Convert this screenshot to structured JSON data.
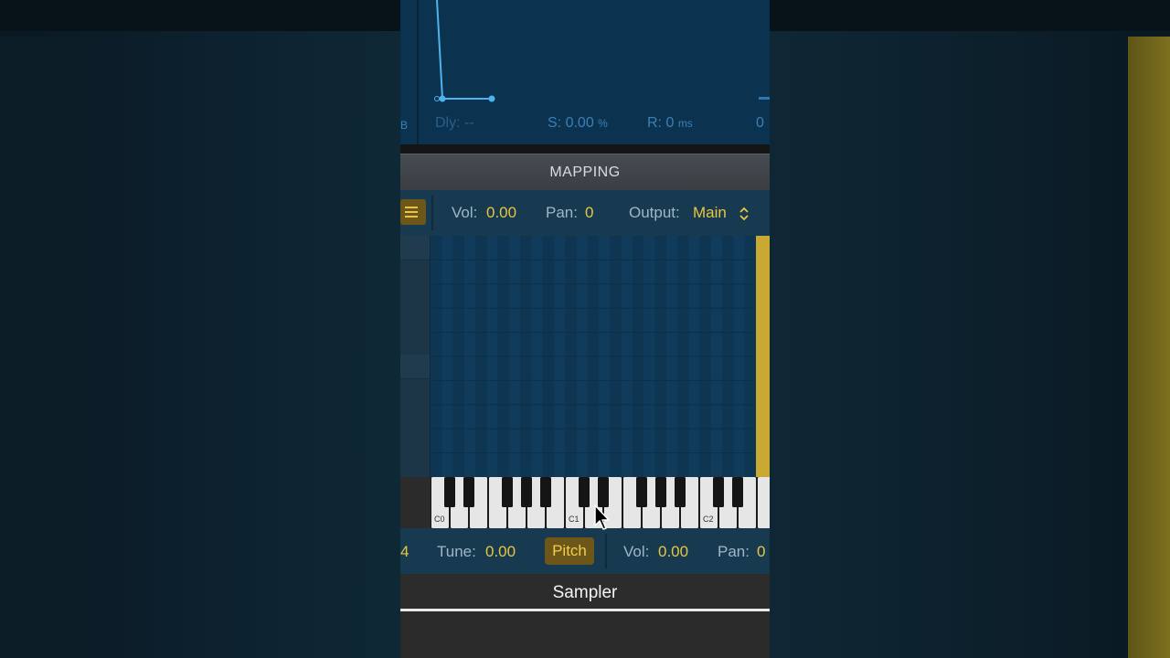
{
  "envelope": {
    "partial_left": "B",
    "delay": "Dly: --",
    "sustain_label": "S:",
    "sustain_value": "0.00",
    "sustain_unit": "%",
    "release_label": "R:",
    "release_value": "0",
    "release_unit": "ms",
    "partial_right": "0"
  },
  "mapping": {
    "title": "MAPPING",
    "vol_label": "Vol:",
    "vol_value": "0.00",
    "pan_label": "Pan:",
    "pan_value": "0",
    "output_label": "Output:",
    "output_value": "Main"
  },
  "keyboard": {
    "labels": [
      "C0",
      "C1",
      "C2"
    ]
  },
  "zone_params": {
    "partial_value": "4",
    "tune_label": "Tune:",
    "tune_value": "0.00",
    "pitch_button": "Pitch",
    "vol_label": "Vol:",
    "vol_value": "0.00",
    "pan_label": "Pan:",
    "pan_value": "0"
  },
  "app": {
    "title": "Sampler"
  },
  "colors": {
    "accent": "#e8c640",
    "panel_blue": "#173a51",
    "envelope_line": "#4fb2ef"
  }
}
